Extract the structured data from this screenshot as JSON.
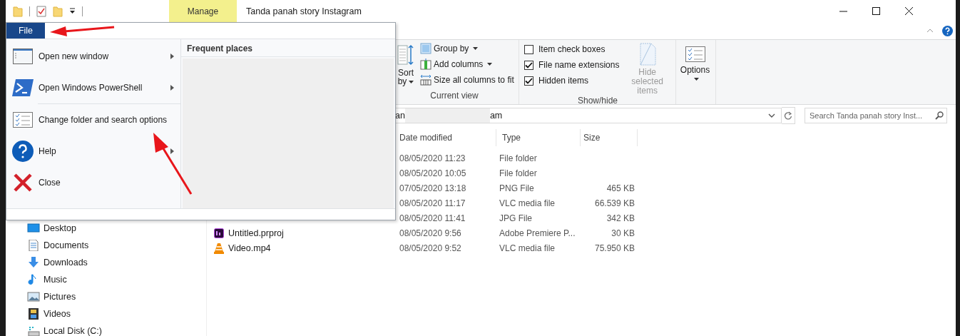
{
  "window": {
    "title": "Tanda panah story Instagram",
    "context_tab": "Manage"
  },
  "file_menu": {
    "tab": "File",
    "items": [
      {
        "kind": "window",
        "label": "Open new window",
        "submenu": true
      },
      {
        "kind": "powershell",
        "label": "Open Windows PowerShell",
        "submenu": true
      },
      {
        "kind": "options",
        "label": "Change folder and search options",
        "submenu": false
      },
      {
        "kind": "help",
        "label": "Help",
        "submenu": true
      },
      {
        "kind": "close",
        "label": "Close",
        "submenu": false
      }
    ],
    "frequent_places": "Frequent places"
  },
  "ribbon": {
    "current_view": {
      "sort": "Sort by",
      "buttons": [
        {
          "kind": "group",
          "label": "Group by",
          "dropdown": true
        },
        {
          "kind": "columns",
          "label": "Add columns",
          "dropdown": true
        },
        {
          "kind": "fit",
          "label": "Size all columns to fit",
          "dropdown": false
        }
      ],
      "label": "Current view"
    },
    "show_hide": {
      "checkboxes": [
        {
          "label": "Item check boxes",
          "checked": false
        },
        {
          "label": "File name extensions",
          "checked": true
        },
        {
          "label": "Hidden items",
          "checked": true
        }
      ],
      "hide_selected": {
        "label": "Hide selected items",
        "disabled": true
      },
      "label": "Show/hide"
    },
    "options": {
      "label": "Options"
    }
  },
  "address": {
    "start": "an",
    "end": "am"
  },
  "search": {
    "placeholder": "Search Tanda panah story Inst..."
  },
  "navigation": [
    {
      "kind": "desktop",
      "label": "Desktop"
    },
    {
      "kind": "documents",
      "label": "Documents"
    },
    {
      "kind": "downloads",
      "label": "Downloads"
    },
    {
      "kind": "music",
      "label": "Music"
    },
    {
      "kind": "pictures",
      "label": "Pictures"
    },
    {
      "kind": "videos",
      "label": "Videos"
    },
    {
      "kind": "disk",
      "label": "Local Disk (C:)"
    }
  ],
  "file_list": {
    "columns": [
      "Date modified",
      "Type",
      "Size"
    ],
    "rows": [
      {
        "date": "08/05/2020 11:23",
        "type": "File folder"
      },
      {
        "date": "08/05/2020 10:05",
        "type": "File folder"
      },
      {
        "date": "07/05/2020 13:18",
        "type": "PNG File",
        "size": "465 KB"
      },
      {
        "date": "08/05/2020 11:17",
        "type": "VLC media file",
        "size": "66.539 KB"
      },
      {
        "date": "08/05/2020 11:41",
        "type": "JPG File",
        "size": "342 KB"
      },
      {
        "kind": "premiere",
        "name": "Untitled.prproj",
        "date": "08/05/2020 9:56",
        "type": "Adobe Premiere P...",
        "size": "30 KB"
      },
      {
        "kind": "vlc",
        "name": "Video.mp4",
        "date": "08/05/2020 9:52",
        "type": "VLC media file",
        "size": "75.950 KB"
      }
    ]
  }
}
